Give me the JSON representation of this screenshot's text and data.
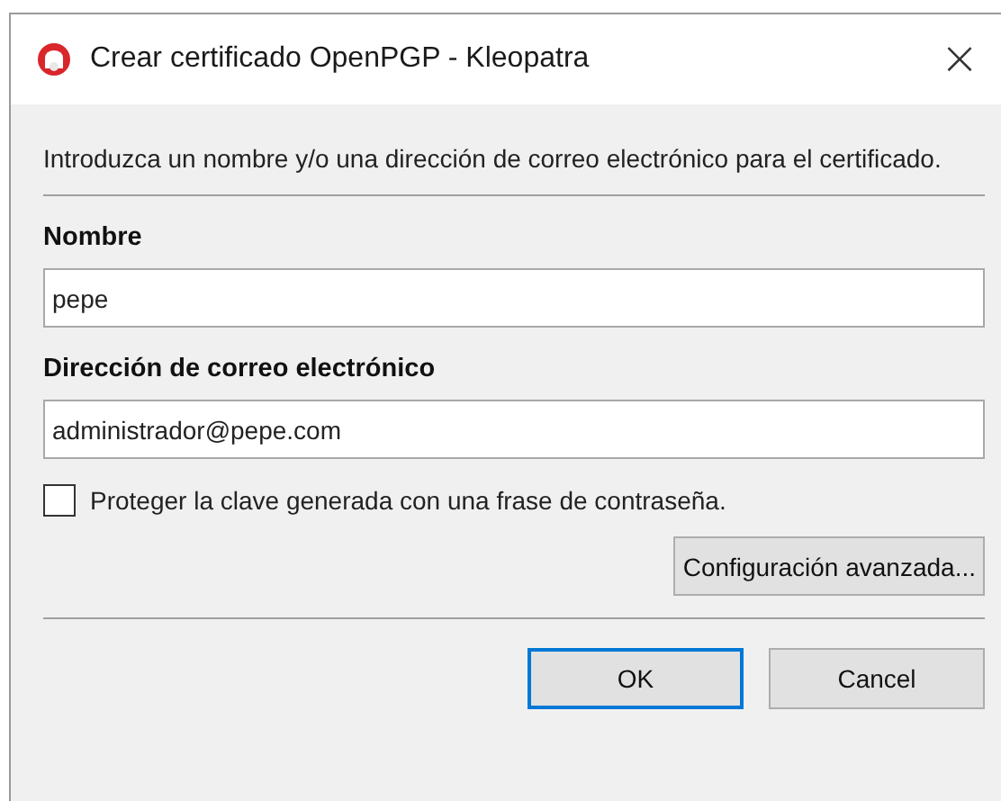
{
  "window": {
    "title": "Crear certificado OpenPGP - Kleopatra",
    "close": "×"
  },
  "intro": "Introduzca un nombre y/o una dirección de correo electrónico para el certificado.",
  "fields": [
    {
      "label": "Nombre",
      "value": "pepe"
    },
    {
      "label": "Dirección de correo electrónico",
      "value": "administrador@pepe.com"
    }
  ],
  "protect": {
    "label": "Proteger la clave generada con una frase de contraseña.",
    "checked": false
  },
  "advanced_button": "Configuración avanzada...",
  "buttons": [
    {
      "label": "OK",
      "selected": true
    },
    {
      "label": "Cancel",
      "selected": false
    }
  ]
}
